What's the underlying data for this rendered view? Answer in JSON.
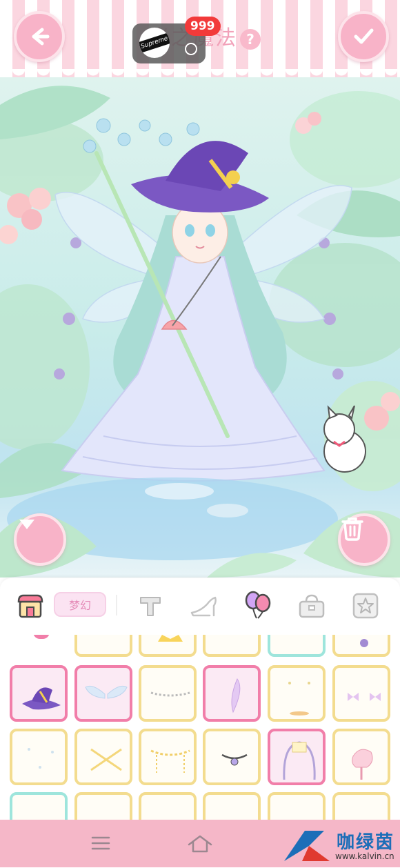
{
  "header": {
    "title": "光之魔法",
    "help_label": "?",
    "notification": {
      "logo_text": "Supreme",
      "badge_count": "999"
    }
  },
  "icons": {
    "back": "back-arrow-icon",
    "confirm": "check-icon",
    "collapse": "chevron-down-icon",
    "trash": "trash-icon"
  },
  "tabs": [
    {
      "name": "shop-icon",
      "active": false
    },
    {
      "name": "category-label",
      "label": "梦幻",
      "active": true
    },
    {
      "name": "text-tool-icon",
      "active": false
    },
    {
      "name": "shoe-icon",
      "active": false
    },
    {
      "name": "balloon-icon",
      "active": true
    },
    {
      "name": "bag-icon",
      "active": false
    },
    {
      "name": "star-icon",
      "active": false
    }
  ],
  "grid_items": [
    {
      "row": 0,
      "items": [
        "partial",
        "crown",
        "partial",
        "partial-teal",
        "ornament"
      ]
    },
    {
      "row": 1,
      "items": [
        "witch-hat",
        "wings",
        "necklace",
        "feather",
        "sparkles",
        "bows"
      ]
    },
    {
      "row": 2,
      "items": [
        "snow",
        "crossed-wands",
        "gold-chain",
        "gem-necklace",
        "flower-arch",
        "carousel"
      ]
    },
    {
      "row": 3,
      "items": [
        "partial-teal",
        "partial",
        "partial",
        "partial",
        "partial",
        "partial"
      ]
    }
  ],
  "colors": {
    "accent_pink": "#f8b3c8",
    "selected_border": "#f17ea9",
    "cell_border": "#f3dc8f",
    "badge_red": "#f23a3a"
  },
  "bottom_bar": {
    "watermark_name": "咖绿茵",
    "watermark_url": "www.kalvin.cn"
  }
}
